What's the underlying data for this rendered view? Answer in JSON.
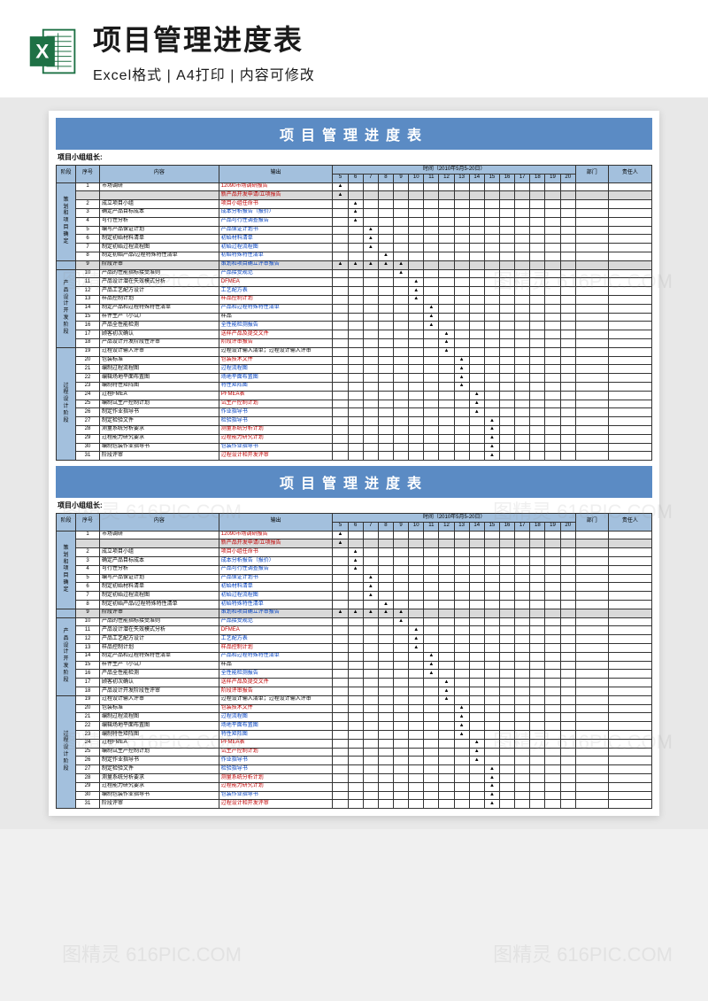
{
  "header": {
    "title": "项目管理进度表",
    "subtitle": "Excel格式 | A4打印 | 内容可修改"
  },
  "table": {
    "title": "项目管理进度表",
    "group_leader_label": "项目小组组长:",
    "columns": {
      "phase": "阶段",
      "seq": "序号",
      "content": "内容",
      "output": "输出",
      "time_label": "时间（2010年5月5-20日）",
      "dept": "部门",
      "person": "责任人"
    },
    "days": [
      "5",
      "6",
      "7",
      "8",
      "9",
      "10",
      "11",
      "12",
      "13",
      "14",
      "15",
      "16",
      "17",
      "18",
      "19",
      "20"
    ],
    "phases": [
      {
        "name": "策划和项目确定",
        "rows": [
          1,
          2,
          3,
          4,
          5,
          6,
          7,
          8
        ]
      },
      {
        "name": "",
        "rows": [
          9
        ],
        "gray": true
      },
      {
        "name": "产品设计开发阶段",
        "rows": [
          10,
          11,
          12,
          13,
          14,
          15,
          16,
          17,
          18
        ]
      },
      {
        "name": "过程设计阶段",
        "rows": [
          19,
          20,
          21,
          22,
          23,
          24,
          25,
          26,
          27,
          28,
          29,
          30,
          31
        ]
      }
    ],
    "rows": [
      {
        "seq": 1,
        "content": "市场调研",
        "output": "12090市场调研报告",
        "outcolor": "red",
        "marks": [
          0
        ]
      },
      {
        "seq": "",
        "content": "",
        "output": "新产品开发申请/立项报告",
        "outcolor": "red",
        "marks": [
          0
        ],
        "gray": true
      },
      {
        "seq": 2,
        "content": "成立项目小组",
        "output": "项目小组任命书",
        "outcolor": "red",
        "marks": [
          1
        ]
      },
      {
        "seq": 3,
        "content": "确定产品目标成本",
        "output": "成本分析报告（报价）",
        "outcolor": "blue",
        "marks": [
          1
        ]
      },
      {
        "seq": 4,
        "content": "可行性分析",
        "output": "产品可行性调查报告",
        "outcolor": "blue",
        "marks": [
          1
        ]
      },
      {
        "seq": 5,
        "content": "编写产品保证计划",
        "output": "产品保证计划书",
        "outcolor": "blue",
        "marks": [
          2
        ]
      },
      {
        "seq": 6,
        "content": "制定初始材料清单",
        "output": "初始材料清单",
        "outcolor": "blue",
        "marks": [
          2
        ]
      },
      {
        "seq": 7,
        "content": "制定初始过程流程图",
        "output": "初始过程流程图",
        "outcolor": "blue",
        "marks": [
          2
        ]
      },
      {
        "seq": 8,
        "content": "制定初始产品/过程特殊特性清单",
        "output": "初始特殊特性清单",
        "outcolor": "blue",
        "marks": [
          3
        ]
      },
      {
        "seq": 9,
        "content": "阶段评审",
        "output": "策划和项目确立评审报告",
        "outcolor": "blue",
        "marks": [
          0,
          1,
          2,
          3,
          4
        ],
        "gray": true
      },
      {
        "seq": 10,
        "content": "产品的性能指标接受准则",
        "output": "产品接受规范",
        "outcolor": "blue",
        "marks": [
          4
        ]
      },
      {
        "seq": 11,
        "content": "产品设计潜在失效模式分析",
        "output": "DFMEA",
        "outcolor": "red",
        "marks": [
          5
        ]
      },
      {
        "seq": 12,
        "content": "产品工艺配方设计",
        "output": "工艺配方表",
        "outcolor": "blue",
        "marks": [
          5
        ]
      },
      {
        "seq": 13,
        "content": "样品控制计划",
        "output": "样品控制计划",
        "outcolor": "red",
        "marks": [
          5
        ]
      },
      {
        "seq": 14,
        "content": "制定产品和过程特殊特性清单",
        "output": "产品和过程特殊特性清单",
        "outcolor": "blue",
        "marks": [
          6
        ]
      },
      {
        "seq": 15,
        "content": "样件生产（小试）",
        "output": "样品",
        "outcolor": "",
        "marks": [
          6
        ]
      },
      {
        "seq": 16,
        "content": "产品全性能检测",
        "output": "全性能检测报告",
        "outcolor": "blue",
        "marks": [
          6
        ]
      },
      {
        "seq": 17,
        "content": "顾客初次确认",
        "output": "送样产品及提交文件",
        "outcolor": "red",
        "marks": [
          7
        ]
      },
      {
        "seq": 18,
        "content": "产品设计开发阶段性评审",
        "output": "阶段评审报告",
        "outcolor": "red",
        "marks": [
          7
        ]
      },
      {
        "seq": 19,
        "content": "过程设计输入评审",
        "output": "过程设计输入清单；过程设计输入评审",
        "outcolor": "",
        "marks": [
          7
        ]
      },
      {
        "seq": 20,
        "content": "包装标准",
        "output": "包装技术文件",
        "outcolor": "red",
        "marks": [
          8
        ]
      },
      {
        "seq": 21,
        "content": "编制过程流程图",
        "output": "过程流程图",
        "outcolor": "blue",
        "marks": [
          8
        ]
      },
      {
        "seq": 22,
        "content": "编辑场地平面布置图",
        "output": "场地平面布置图",
        "outcolor": "blue",
        "marks": [
          8
        ]
      },
      {
        "seq": 23,
        "content": "编制特性矩阵图",
        "output": "特性矩阵图",
        "outcolor": "blue",
        "marks": [
          8
        ]
      },
      {
        "seq": 24,
        "content": "过程FMEA",
        "output": "PFMEA表",
        "outcolor": "red",
        "marks": [
          9
        ]
      },
      {
        "seq": 25,
        "content": "编制试生产控制计划",
        "output": "试生产控制计划",
        "outcolor": "red",
        "marks": [
          9
        ]
      },
      {
        "seq": 26,
        "content": "制定作业指导书",
        "output": "作业指导书",
        "outcolor": "blue",
        "marks": [
          9
        ]
      },
      {
        "seq": 27,
        "content": "制定检验文件",
        "output": "检验指导书",
        "outcolor": "blue",
        "marks": [
          10
        ]
      },
      {
        "seq": 28,
        "content": "测量系统分析要求",
        "output": "测量系统分析计划",
        "outcolor": "red",
        "marks": [
          10
        ]
      },
      {
        "seq": 29,
        "content": "过程能力研究要求",
        "output": "过程能力研究计划",
        "outcolor": "red",
        "marks": [
          10
        ]
      },
      {
        "seq": 30,
        "content": "编制包装作业指导书",
        "output": "包装作业指导书",
        "outcolor": "blue",
        "marks": [
          10
        ]
      },
      {
        "seq": 31,
        "content": "阶段评审",
        "output": "过程设计和开发评审",
        "outcolor": "red",
        "marks": [
          10
        ]
      }
    ]
  },
  "watermark": "图精灵 616PIC.COM"
}
